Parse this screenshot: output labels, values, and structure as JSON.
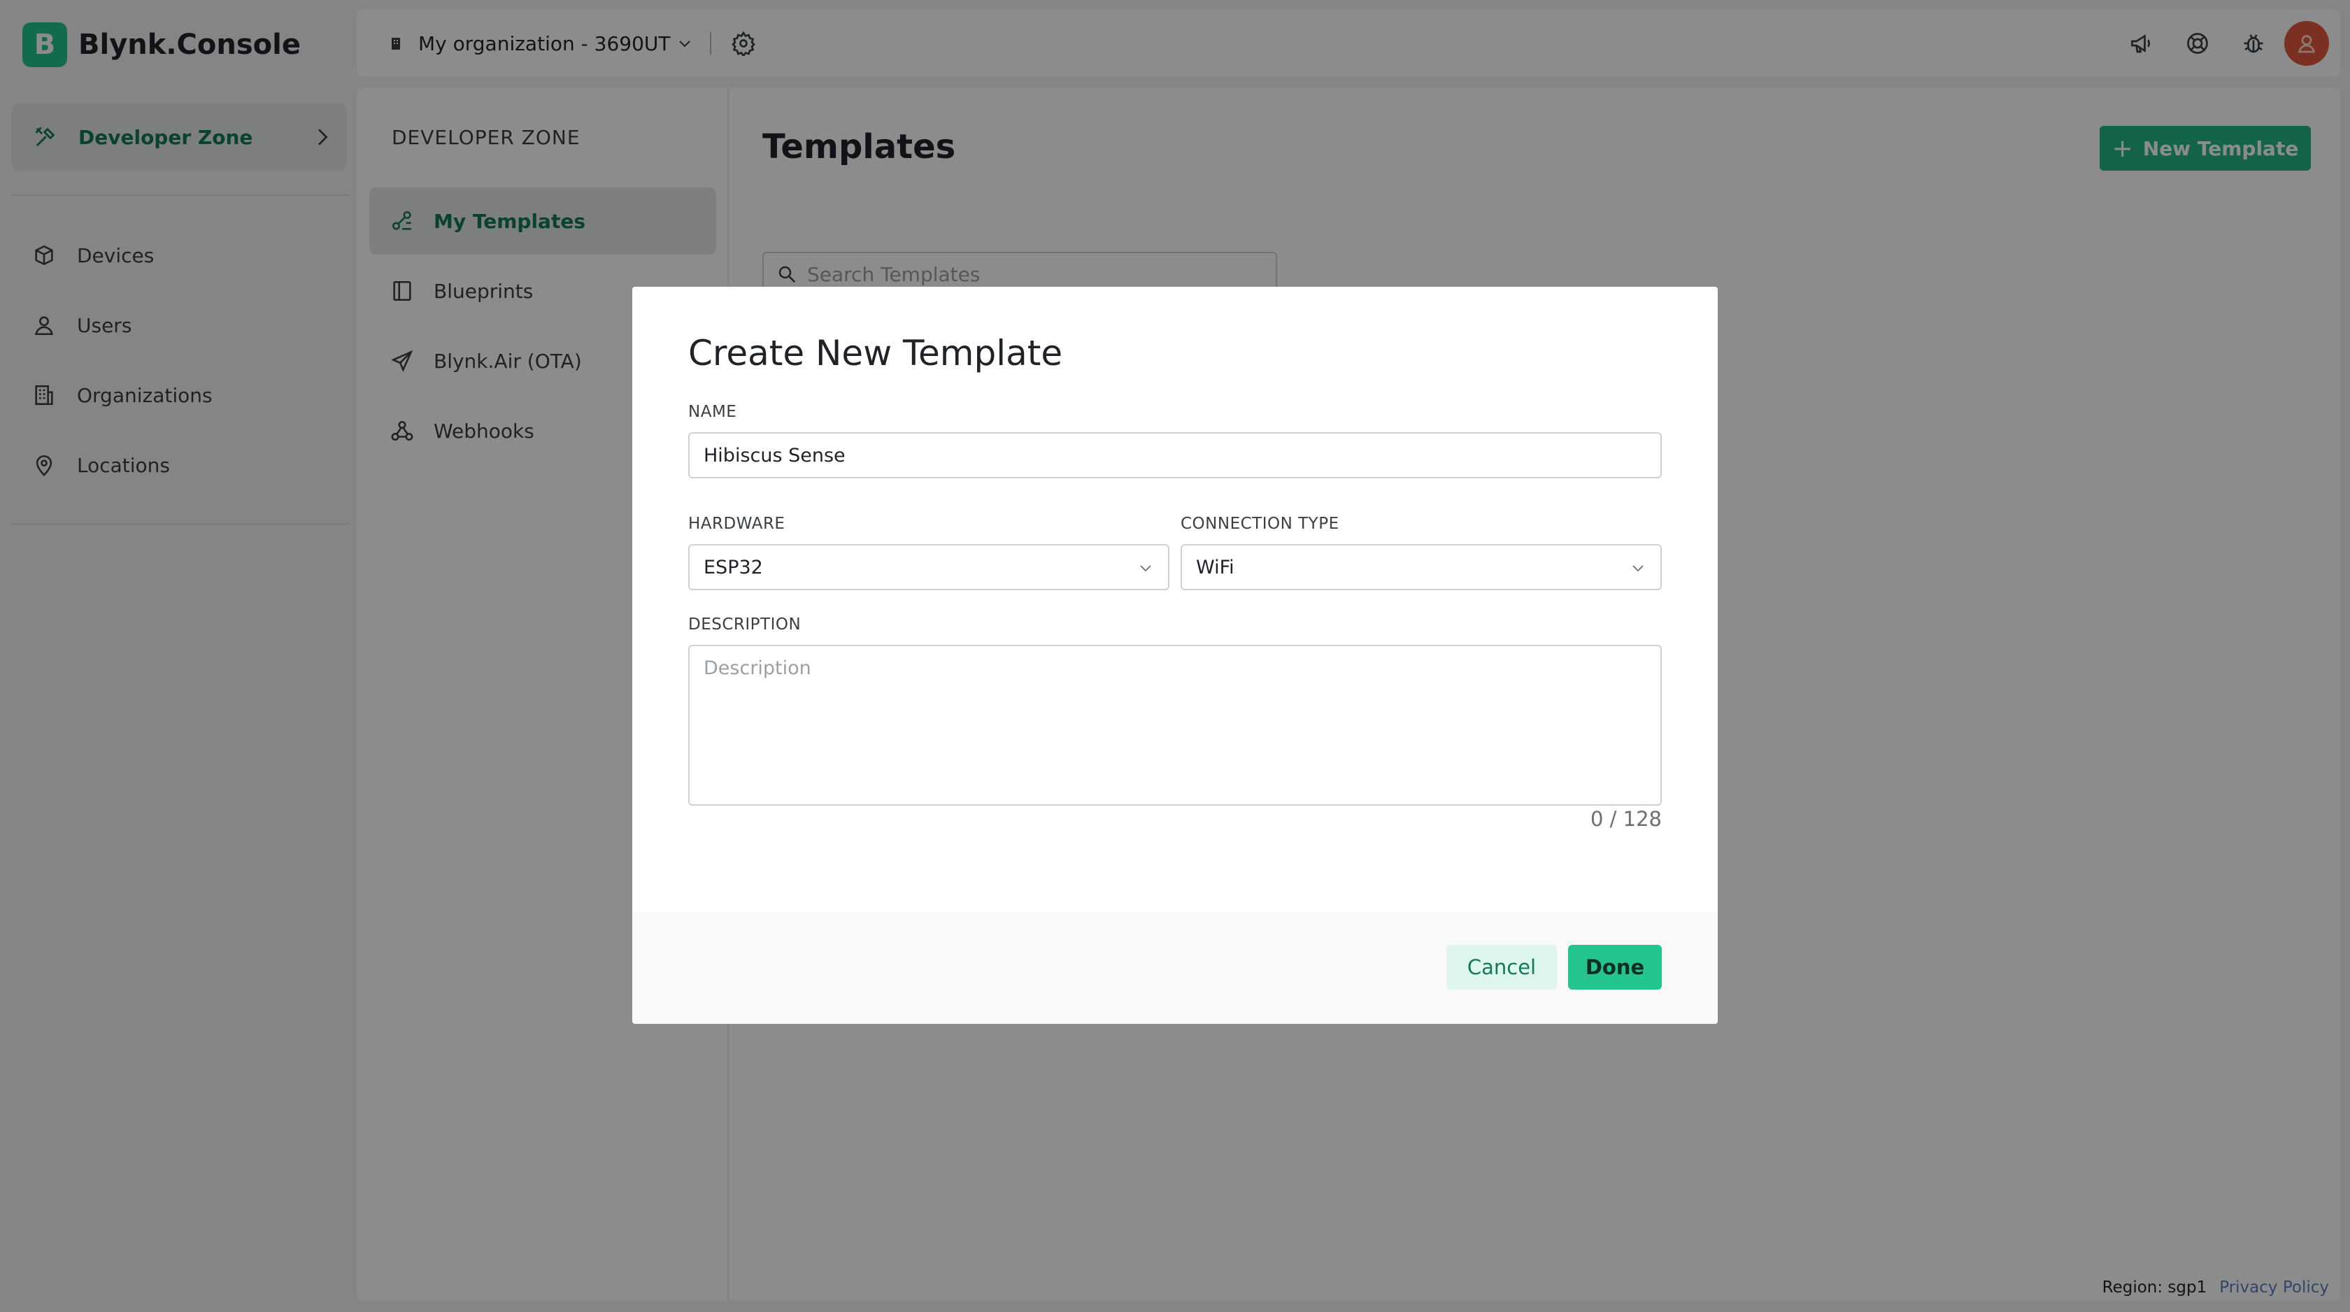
{
  "app": {
    "brand_letter": "B",
    "brand_name": "Blynk.Console",
    "brand_color": "#23c48e"
  },
  "sidebar": {
    "developer_zone": {
      "label": "Developer Zone",
      "icon": "tools-icon"
    },
    "items": [
      {
        "label": "Devices",
        "icon": "cube-icon"
      },
      {
        "label": "Users",
        "icon": "user-icon"
      },
      {
        "label": "Organizations",
        "icon": "building-icon"
      },
      {
        "label": "Locations",
        "icon": "pin-icon"
      }
    ]
  },
  "header": {
    "organization": "My organization - 3690UT",
    "icons": [
      "megaphone-icon",
      "lifebuoy-icon",
      "bug-icon",
      "avatar"
    ]
  },
  "subnav": {
    "title": "DEVELOPER ZONE",
    "items": [
      {
        "label": "My Templates",
        "icon": "templates-icon",
        "active": true
      },
      {
        "label": "Blueprints",
        "icon": "book-icon",
        "active": false
      },
      {
        "label": "Blynk.Air (OTA)",
        "icon": "paper-plane-icon",
        "active": false
      },
      {
        "label": "Webhooks",
        "icon": "webhook-icon",
        "active": false
      }
    ]
  },
  "main": {
    "title": "Templates",
    "new_template_label": "New Template",
    "search_placeholder": "Search Templates"
  },
  "modal": {
    "title": "Create New Template",
    "name_label": "NAME",
    "name_value": "Hibiscus Sense",
    "hardware_label": "HARDWARE",
    "hardware_value": "ESP32",
    "connection_label": "CONNECTION TYPE",
    "connection_value": "WiFi",
    "description_label": "DESCRIPTION",
    "description_placeholder": "Description",
    "counter": "0 / 128",
    "cancel_label": "Cancel",
    "done_label": "Done"
  },
  "footer": {
    "region": "Region: sgp1",
    "privacy": "Privacy Policy"
  }
}
